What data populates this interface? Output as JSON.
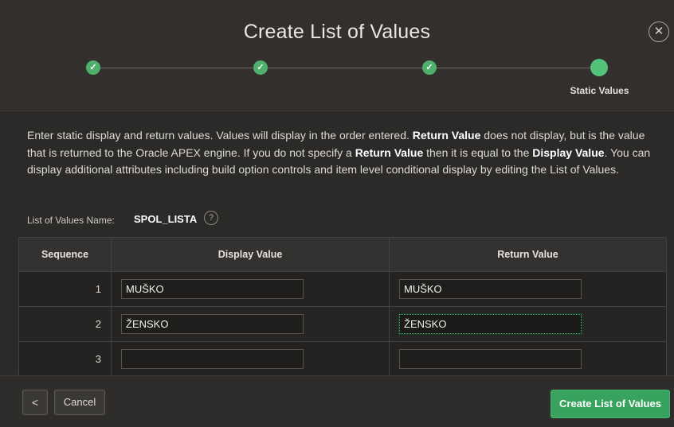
{
  "dialog": {
    "title": "Create List of Values",
    "close_icon_glyph": "✕"
  },
  "wizard": {
    "steps": [
      {
        "status": "complete",
        "icon": "checkmark-icon",
        "glyph": "✓"
      },
      {
        "status": "complete",
        "icon": "checkmark-icon",
        "glyph": "✓"
      },
      {
        "status": "complete",
        "icon": "checkmark-icon",
        "glyph": "✓"
      },
      {
        "status": "current",
        "label": "Static Values"
      }
    ]
  },
  "instructions": {
    "part1": "Enter static display and return values. Values will display in the order entered. ",
    "bold1": "Return Value",
    "part2": " does not display, but is the value that is returned to the Oracle APEX engine. If you do not specify a ",
    "bold2": "Return Value",
    "part3": " then it is equal to the ",
    "bold3": "Display Value",
    "part4": ". You can display additional attributes including build option controls and item level conditional display by editing the List of Values."
  },
  "lov_name": {
    "label": "List of Values Name:",
    "value": "SPOL_LISTA",
    "help_glyph": "?"
  },
  "table": {
    "headers": {
      "sequence": "Sequence",
      "display": "Display Value",
      "return": "Return Value"
    },
    "rows": [
      {
        "sequence": "1",
        "display": "MUŠKO",
        "return": "MUŠKO"
      },
      {
        "sequence": "2",
        "display": "ŽENSKO",
        "return": "ŽENSKO"
      },
      {
        "sequence": "3",
        "display": "",
        "return": ""
      }
    ]
  },
  "footer": {
    "back_glyph": "<",
    "cancel_label": "Cancel",
    "create_label": "Create List of Values"
  },
  "colors": {
    "accent_green": "#38a35e",
    "step_green": "#4fb06d",
    "background": "#2b2a28"
  }
}
